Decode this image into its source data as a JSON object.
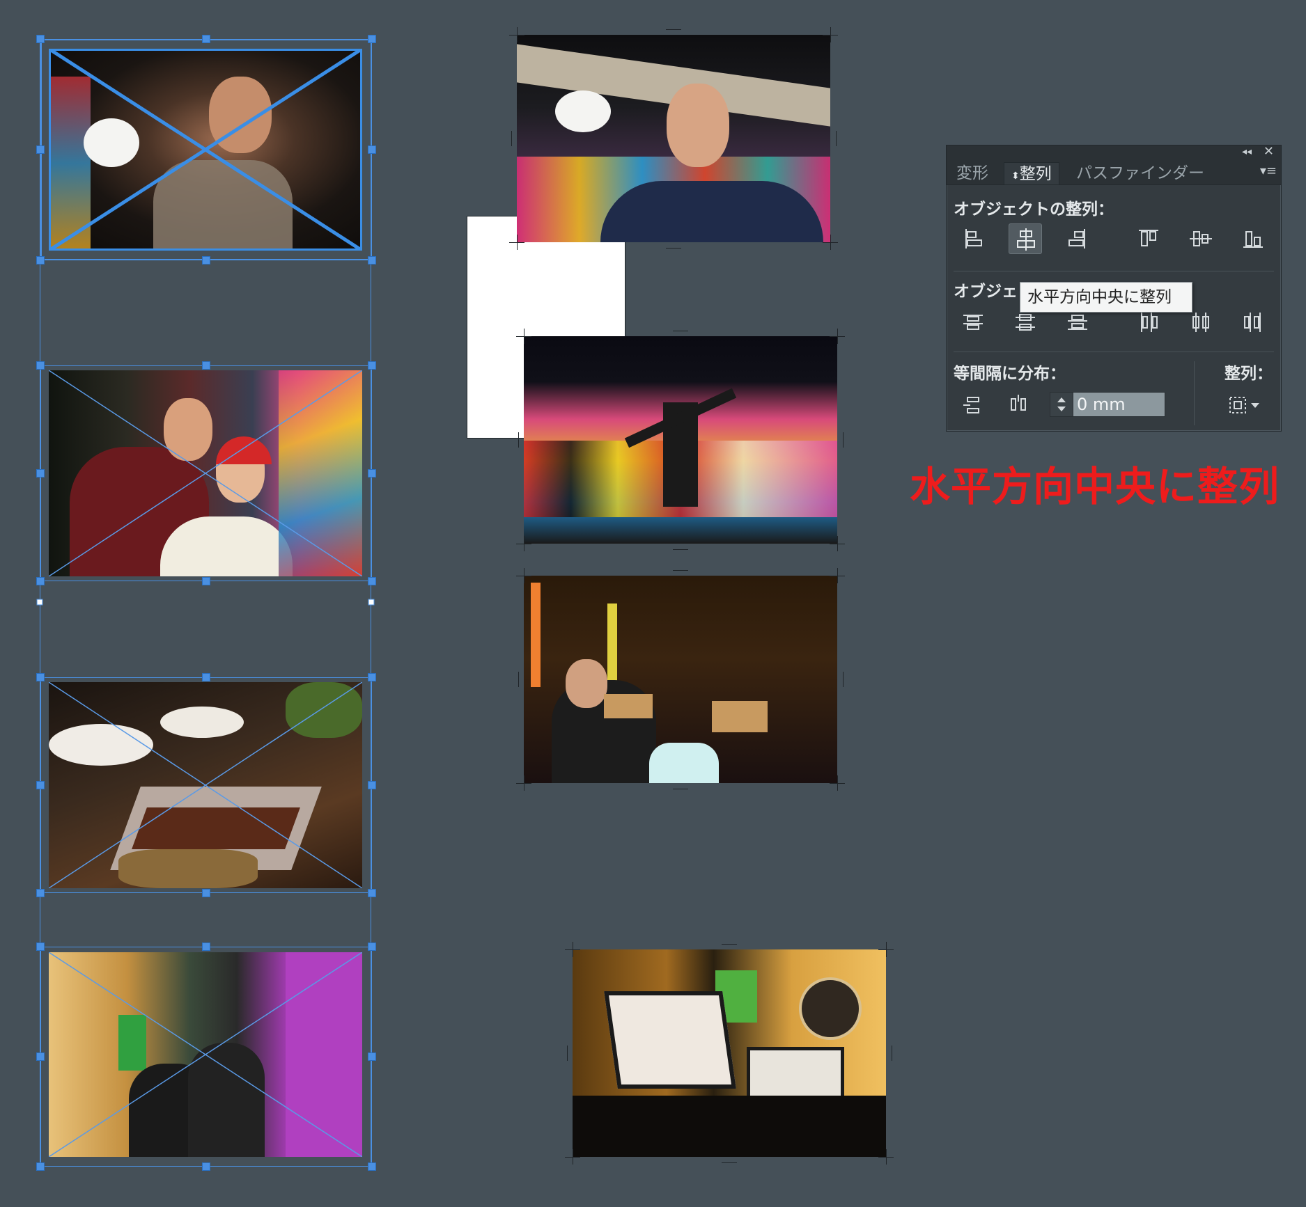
{
  "panel": {
    "tabs": [
      "変形",
      "整列",
      "パスファインダー"
    ],
    "active_tab": "整列",
    "align_objects_label": "オブジェクトの整列：",
    "distribute_objects_label": "オブジェ",
    "distribute_spacing_label": "等間隔に分布：",
    "align_to_label": "整列：",
    "spacing_value": "0 mm",
    "tooltip": "水平方向中央に整列",
    "align_buttons": [
      {
        "name": "align-left-icon",
        "active": false
      },
      {
        "name": "align-horizontal-center-icon",
        "active": true
      },
      {
        "name": "align-right-icon",
        "active": false
      },
      {
        "name": "align-top-icon",
        "active": false
      },
      {
        "name": "align-vertical-center-icon",
        "active": false
      },
      {
        "name": "align-bottom-icon",
        "active": false
      }
    ],
    "distribute_buttons": [
      "distribute-top-icon",
      "distribute-vertical-center-icon",
      "distribute-bottom-icon",
      "distribute-left-icon",
      "distribute-horizontal-center-icon",
      "distribute-right-icon"
    ]
  },
  "annotation": "水平方向中央に整列",
  "colors": {
    "canvas": "#455058",
    "selection": "#4a90e2",
    "annotation": "#ee1c1c",
    "panel": "#343b40"
  }
}
